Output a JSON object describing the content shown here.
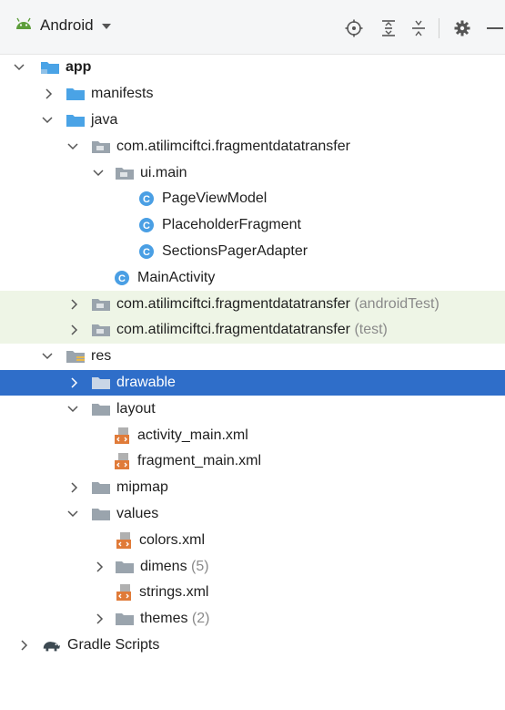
{
  "toolbar": {
    "view_label": "Android",
    "icons": [
      "android-logo-icon",
      "dropdown-caret-icon",
      "locate-icon",
      "expand-all-icon",
      "collapse-all-icon",
      "settings-gear-icon",
      "minimize-icon"
    ]
  },
  "tree": {
    "app": "app",
    "manifests": "manifests",
    "java": "java",
    "pkg_main": "com.atilimciftci.fragmentdatatransfer",
    "ui_main": "ui.main",
    "PageViewModel": "PageViewModel",
    "PlaceholderFragment": "PlaceholderFragment",
    "SectionsPagerAdapter": "SectionsPagerAdapter",
    "MainActivity": "MainActivity",
    "pkg_android_test": "com.atilimciftci.fragmentdatatransfer",
    "pkg_android_test_tag": "(androidTest)",
    "pkg_test": "com.atilimciftci.fragmentdatatransfer",
    "pkg_test_tag": "(test)",
    "res": "res",
    "drawable": "drawable",
    "layout": "layout",
    "activity_main": "activity_main.xml",
    "fragment_main": "fragment_main.xml",
    "mipmap": "mipmap",
    "values": "values",
    "colors": "colors.xml",
    "dimens": "dimens",
    "dimens_count": "(5)",
    "strings": "strings.xml",
    "themes": "themes",
    "themes_count": "(2)",
    "gradle": "Gradle Scripts",
    "class_badge": "C"
  },
  "colors": {
    "selection": "#2f6ec9",
    "test_source_bg": "#eef5e6",
    "folder_blue": "#4aa3e6",
    "kotlin_badge": "#4a9fe4",
    "xml_orange": "#e07b39"
  }
}
